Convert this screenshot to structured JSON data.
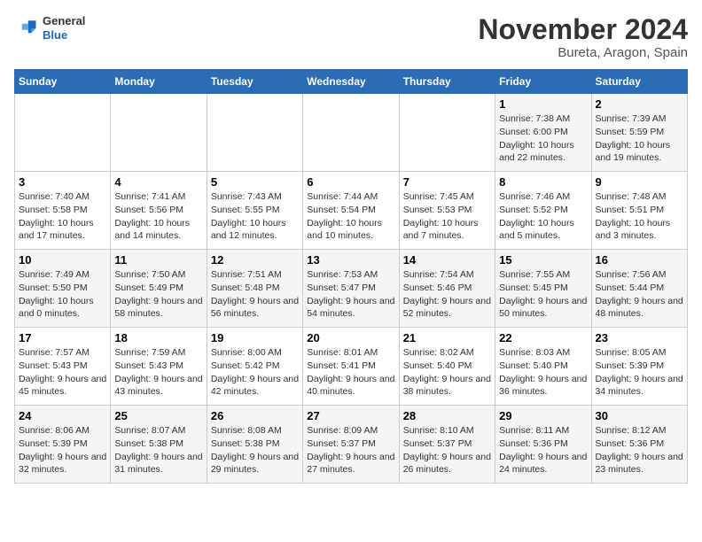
{
  "logo": {
    "general": "General",
    "blue": "Blue"
  },
  "header": {
    "month": "November 2024",
    "location": "Bureta, Aragon, Spain"
  },
  "weekdays": [
    "Sunday",
    "Monday",
    "Tuesday",
    "Wednesday",
    "Thursday",
    "Friday",
    "Saturday"
  ],
  "weeks": [
    [
      {
        "day": "",
        "info": ""
      },
      {
        "day": "",
        "info": ""
      },
      {
        "day": "",
        "info": ""
      },
      {
        "day": "",
        "info": ""
      },
      {
        "day": "",
        "info": ""
      },
      {
        "day": "1",
        "info": "Sunrise: 7:38 AM\nSunset: 6:00 PM\nDaylight: 10 hours and 22 minutes."
      },
      {
        "day": "2",
        "info": "Sunrise: 7:39 AM\nSunset: 5:59 PM\nDaylight: 10 hours and 19 minutes."
      }
    ],
    [
      {
        "day": "3",
        "info": "Sunrise: 7:40 AM\nSunset: 5:58 PM\nDaylight: 10 hours and 17 minutes."
      },
      {
        "day": "4",
        "info": "Sunrise: 7:41 AM\nSunset: 5:56 PM\nDaylight: 10 hours and 14 minutes."
      },
      {
        "day": "5",
        "info": "Sunrise: 7:43 AM\nSunset: 5:55 PM\nDaylight: 10 hours and 12 minutes."
      },
      {
        "day": "6",
        "info": "Sunrise: 7:44 AM\nSunset: 5:54 PM\nDaylight: 10 hours and 10 minutes."
      },
      {
        "day": "7",
        "info": "Sunrise: 7:45 AM\nSunset: 5:53 PM\nDaylight: 10 hours and 7 minutes."
      },
      {
        "day": "8",
        "info": "Sunrise: 7:46 AM\nSunset: 5:52 PM\nDaylight: 10 hours and 5 minutes."
      },
      {
        "day": "9",
        "info": "Sunrise: 7:48 AM\nSunset: 5:51 PM\nDaylight: 10 hours and 3 minutes."
      }
    ],
    [
      {
        "day": "10",
        "info": "Sunrise: 7:49 AM\nSunset: 5:50 PM\nDaylight: 10 hours and 0 minutes."
      },
      {
        "day": "11",
        "info": "Sunrise: 7:50 AM\nSunset: 5:49 PM\nDaylight: 9 hours and 58 minutes."
      },
      {
        "day": "12",
        "info": "Sunrise: 7:51 AM\nSunset: 5:48 PM\nDaylight: 9 hours and 56 minutes."
      },
      {
        "day": "13",
        "info": "Sunrise: 7:53 AM\nSunset: 5:47 PM\nDaylight: 9 hours and 54 minutes."
      },
      {
        "day": "14",
        "info": "Sunrise: 7:54 AM\nSunset: 5:46 PM\nDaylight: 9 hours and 52 minutes."
      },
      {
        "day": "15",
        "info": "Sunrise: 7:55 AM\nSunset: 5:45 PM\nDaylight: 9 hours and 50 minutes."
      },
      {
        "day": "16",
        "info": "Sunrise: 7:56 AM\nSunset: 5:44 PM\nDaylight: 9 hours and 48 minutes."
      }
    ],
    [
      {
        "day": "17",
        "info": "Sunrise: 7:57 AM\nSunset: 5:43 PM\nDaylight: 9 hours and 45 minutes."
      },
      {
        "day": "18",
        "info": "Sunrise: 7:59 AM\nSunset: 5:43 PM\nDaylight: 9 hours and 43 minutes."
      },
      {
        "day": "19",
        "info": "Sunrise: 8:00 AM\nSunset: 5:42 PM\nDaylight: 9 hours and 42 minutes."
      },
      {
        "day": "20",
        "info": "Sunrise: 8:01 AM\nSunset: 5:41 PM\nDaylight: 9 hours and 40 minutes."
      },
      {
        "day": "21",
        "info": "Sunrise: 8:02 AM\nSunset: 5:40 PM\nDaylight: 9 hours and 38 minutes."
      },
      {
        "day": "22",
        "info": "Sunrise: 8:03 AM\nSunset: 5:40 PM\nDaylight: 9 hours and 36 minutes."
      },
      {
        "day": "23",
        "info": "Sunrise: 8:05 AM\nSunset: 5:39 PM\nDaylight: 9 hours and 34 minutes."
      }
    ],
    [
      {
        "day": "24",
        "info": "Sunrise: 8:06 AM\nSunset: 5:39 PM\nDaylight: 9 hours and 32 minutes."
      },
      {
        "day": "25",
        "info": "Sunrise: 8:07 AM\nSunset: 5:38 PM\nDaylight: 9 hours and 31 minutes."
      },
      {
        "day": "26",
        "info": "Sunrise: 8:08 AM\nSunset: 5:38 PM\nDaylight: 9 hours and 29 minutes."
      },
      {
        "day": "27",
        "info": "Sunrise: 8:09 AM\nSunset: 5:37 PM\nDaylight: 9 hours and 27 minutes."
      },
      {
        "day": "28",
        "info": "Sunrise: 8:10 AM\nSunset: 5:37 PM\nDaylight: 9 hours and 26 minutes."
      },
      {
        "day": "29",
        "info": "Sunrise: 8:11 AM\nSunset: 5:36 PM\nDaylight: 9 hours and 24 minutes."
      },
      {
        "day": "30",
        "info": "Sunrise: 8:12 AM\nSunset: 5:36 PM\nDaylight: 9 hours and 23 minutes."
      }
    ]
  ]
}
